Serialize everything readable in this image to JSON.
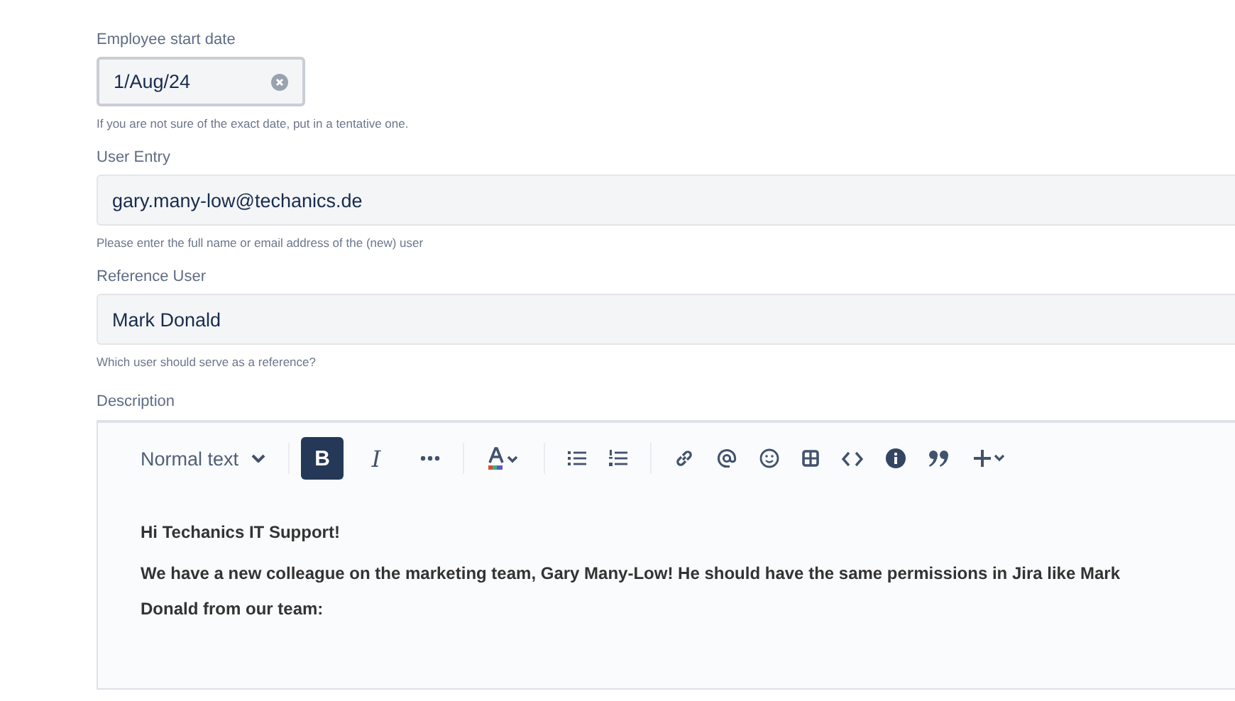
{
  "fields": [
    {
      "kind": "date",
      "label": "Employee start date",
      "value": "1/Aug/24",
      "help": "If you are not sure of the exact date, put in a tentative one."
    },
    {
      "kind": "text",
      "label": "User Entry",
      "value": "gary.many-low@techanics.de",
      "help": "Please enter the full name or email address of the (new) user"
    },
    {
      "kind": "text",
      "label": "Reference User",
      "value": "Mark Donald",
      "help": "Which user should serve as a reference?"
    }
  ],
  "description": {
    "label": "Description",
    "toolbar": [
      [
        {
          "kind": "text-style",
          "label": "Normal text"
        }
      ],
      [
        {
          "kind": "bold",
          "label": "B",
          "selected": true
        },
        {
          "kind": "italic",
          "label": "I",
          "selected": false
        },
        {
          "kind": "more"
        }
      ],
      [
        {
          "kind": "text-color"
        }
      ],
      [
        {
          "kind": "bullet-list"
        },
        {
          "kind": "numbered-list"
        }
      ],
      [
        {
          "kind": "link"
        },
        {
          "kind": "mention"
        },
        {
          "kind": "emoji"
        },
        {
          "kind": "table"
        },
        {
          "kind": "code"
        },
        {
          "kind": "info"
        },
        {
          "kind": "quote"
        },
        {
          "kind": "insert"
        }
      ]
    ],
    "paragraphs": [
      "Hi Techanics IT Support!",
      "We have a new colleague on the marketing team, Gary Many-Low! He should have the same permissions in Jira like Mark Donald from our team:"
    ]
  }
}
